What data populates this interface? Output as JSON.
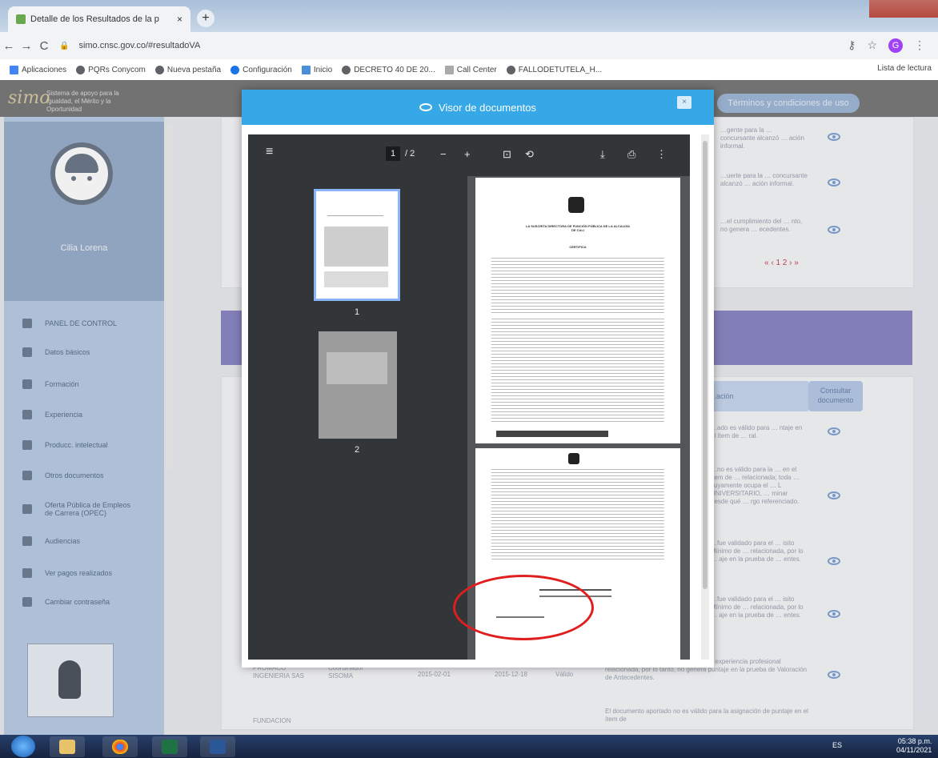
{
  "browser": {
    "tab_title": "Detalle de los Resultados de la p",
    "tab_close": "×",
    "new_tab": "+",
    "url": "simo.cnsc.gov.co/#resultadoVA",
    "back": "←",
    "forward": "→",
    "reload": "C",
    "bookmarks": [
      "Aplicaciones",
      "PQRs Conycom",
      "Nueva pestaña",
      "Configuración",
      "Inicio",
      "DECRETO 40 DE 20...",
      "Call Center",
      "FALLODETUTELA_H..."
    ],
    "reading_list": "Lista de lectura",
    "profile_initial": "G"
  },
  "site": {
    "logo": "simo",
    "logo_tagline": "Sistema de apoyo para la Igualdad, el Mérito y la Oportunidad",
    "terms_button": "Términos y condiciones de uso"
  },
  "sidebar": {
    "user_name": "Cilia Lorena",
    "items": [
      {
        "label": "PANEL DE CONTROL",
        "icon": "dashboard-icon"
      },
      {
        "label": "Datos básicos",
        "icon": "user-card-icon"
      },
      {
        "label": "Formación",
        "icon": "graduation-cap-icon"
      },
      {
        "label": "Experiencia",
        "icon": "briefcase-icon"
      },
      {
        "label": "Producc. intelectual",
        "icon": "book-icon"
      },
      {
        "label": "Otros documentos",
        "icon": "document-icon"
      },
      {
        "label": "Oferta Pública de Empleos de Carrera (OPEC)",
        "icon": "globe-icon"
      },
      {
        "label": "Audiencias",
        "icon": "people-icon"
      },
      {
        "label": "Ver pagos realizados",
        "icon": "dollar-icon"
      },
      {
        "label": "Cambiar contraseña",
        "icon": "lock-icon"
      }
    ]
  },
  "background_content": {
    "top_rows": [
      "…gente para la … concursante alcanzó … ación informal.",
      "…uerte para la … concursante alcanzó … ación informal.",
      "…el cumplimiento del … nto, no genera … ecedentes."
    ],
    "pager": "«  ‹  1  2  ›  »",
    "col_header": "…ación",
    "consultar": "Consultar documento",
    "rows": [
      "…ado es válido para … ntaje en el ítem de … ral.",
      "…no es válido para la … en el ítem de … relacionada; toda … cuyamente ocupa el … L UNIVERSITARIO, … minar desde qué … rgo referenciado.",
      "…fue validado para el … isito Mínimo de … relacionada, por lo … aje en la prueba de … entes.",
      "…fue validado para el … isito Mínimo de … relacionada, por lo … aje en la prueba de … entes."
    ],
    "last_row": {
      "company": "PROMACO INGENIERIA SAS",
      "role": "Coordinador SISOMA",
      "start": "2015-02-01",
      "end": "2015-12-18",
      "status": "Válido",
      "obs": "cumplimiento del Requisito Mínimo de experiencia profesional relacionada, por lo tanto, no genera puntaje en la prueba de Valoración de Antecedentes."
    },
    "next_row_company": "FUNDACION",
    "next_row_obs": "El documento aportado no es válido para la asignación de puntaje en el ítem de"
  },
  "modal": {
    "title": "Visor de documentos",
    "close": "×"
  },
  "pdf_viewer": {
    "current_page": "1",
    "page_total": "/ 2",
    "zoom_out": "−",
    "zoom_in": "+",
    "thumbnails": [
      "1",
      "2"
    ],
    "doc_heading": "LA SUSCRITA DIRECTORA DE FUNCIÓN PÚBLICA DE LA ALCALDÍA DE CALI",
    "doc_subheading": "CERTIFICA"
  },
  "taskbar": {
    "lang": "ES",
    "time": "05:38 p.m.",
    "date": "04/11/2021"
  },
  "colors": {
    "modal_header": "#36a8e8",
    "sidebar": "#b9cde6",
    "purple_band": "#8b86c4",
    "annotation_circle": "#e01e1e"
  }
}
